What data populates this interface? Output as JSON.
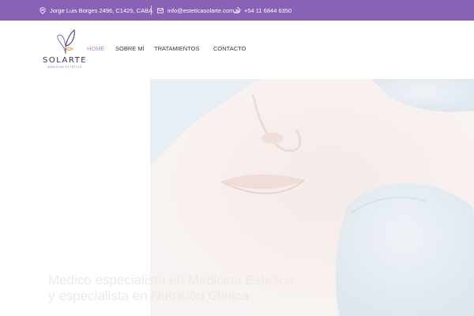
{
  "topbar": {
    "address": "Jorge Luis Borges 2496, C1425, CABA",
    "email": "info@esteticasolarte.com.ar",
    "phone": "+54 11 6844 6350",
    "icons": [
      "location-pin-icon",
      "mail-icon",
      "whatsapp-icon"
    ]
  },
  "logo": {
    "brand": "SOLARTE",
    "tagline": "Medicina Estética"
  },
  "nav": {
    "items": [
      {
        "label": "HOME",
        "active": true
      },
      {
        "label": "SOBRE MÍ",
        "active": false
      },
      {
        "label": "TRATAMIENTOS",
        "active": false
      },
      {
        "label": "CONTACTO",
        "active": false
      }
    ]
  },
  "hero": {
    "headline": "Medico especialista en Medicina Estetica y especialista en Nutrición Clínica"
  },
  "colors": {
    "topbar": "#8a62b5",
    "nav_active": "#b08bd1",
    "nav_text": "#3a3a3a",
    "logo_text": "#3a3060"
  }
}
